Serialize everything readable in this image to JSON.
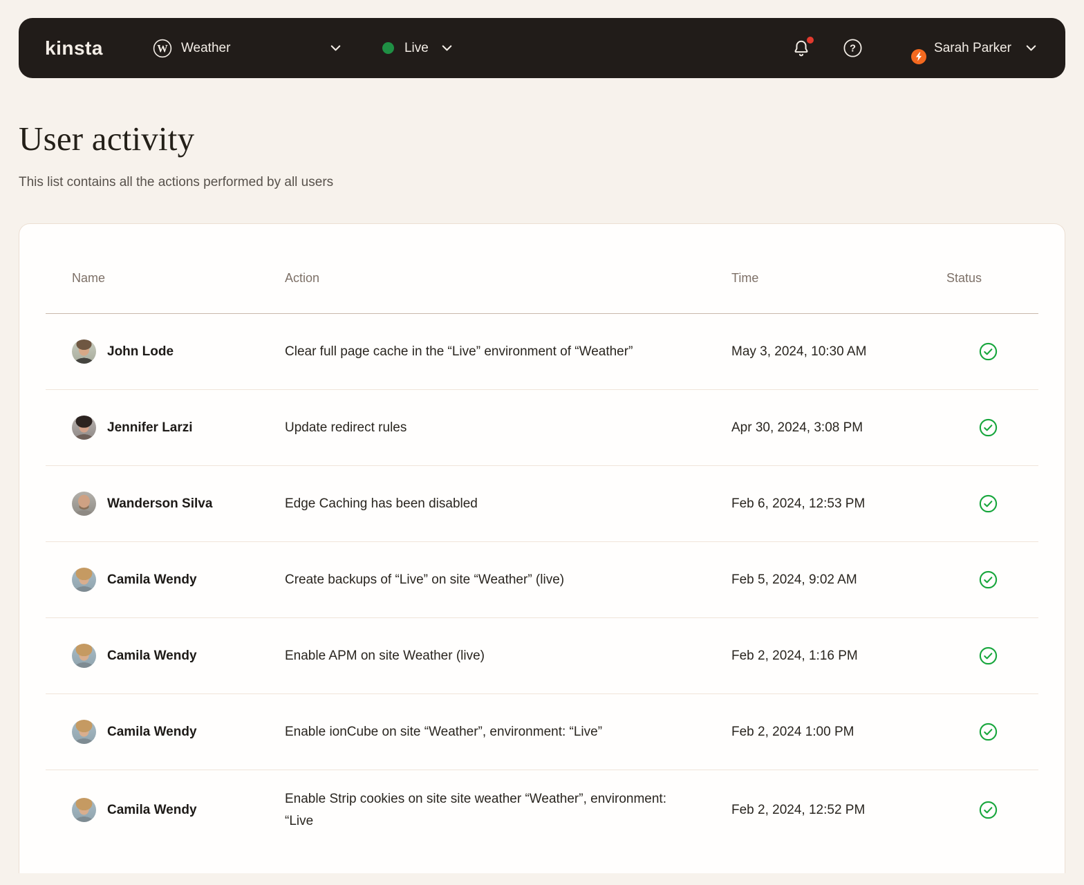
{
  "navbar": {
    "brand": "kinsta",
    "site_selector": {
      "label": "Weather",
      "icon": "wordpress-icon"
    },
    "env_selector": {
      "label": "Live",
      "status": "live"
    },
    "notifications": {
      "has_unread": true
    },
    "user_menu": {
      "name": "Sarah Parker"
    }
  },
  "page": {
    "title": "User activity",
    "subtitle": "This list contains all the actions performed by all users"
  },
  "table": {
    "columns": [
      "Name",
      "Action",
      "Time",
      "Status"
    ],
    "rows": [
      {
        "name": "John Lode",
        "avatar": "john",
        "action": "Clear full page cache in the “Live” environment of “Weather”",
        "time": "May 3, 2024, 10:30 AM",
        "status": "success"
      },
      {
        "name": "Jennifer Larzi",
        "avatar": "jennifer",
        "action": "Update redirect rules",
        "time": "Apr 30, 2024, 3:08 PM",
        "status": "success"
      },
      {
        "name": "Wanderson Silva",
        "avatar": "wanderson",
        "action": "Edge Caching has been disabled",
        "time": "Feb 6, 2024, 12:53 PM",
        "status": "success"
      },
      {
        "name": "Camila Wendy",
        "avatar": "camila",
        "action": "Create backups of “Live” on site “Weather” (live)",
        "time": "Feb 5, 2024, 9:02 AM",
        "status": "success"
      },
      {
        "name": "Camila Wendy",
        "avatar": "camila",
        "action": "Enable APM on site Weather (live)",
        "time": "Feb 2, 2024, 1:16 PM",
        "status": "success"
      },
      {
        "name": "Camila Wendy",
        "avatar": "camila",
        "action": "Enable ionCube on site “Weather”, environment: “Live”",
        "time": "Feb 2, 2024 1:00 PM",
        "status": "success"
      },
      {
        "name": "Camila Wendy",
        "avatar": "camila",
        "action": "Enable Strip cookies on site site weather “Weather”, environment: “Live",
        "time": "Feb 2, 2024, 12:52 PM",
        "status": "success"
      }
    ]
  },
  "colors": {
    "navbar-bg": "#211c19",
    "page-bg": "#f7f2ec",
    "success-green": "#17a63c",
    "live-green": "#1f8f44",
    "notification-red": "#e23a2e",
    "badge-orange": "#f4691f"
  }
}
